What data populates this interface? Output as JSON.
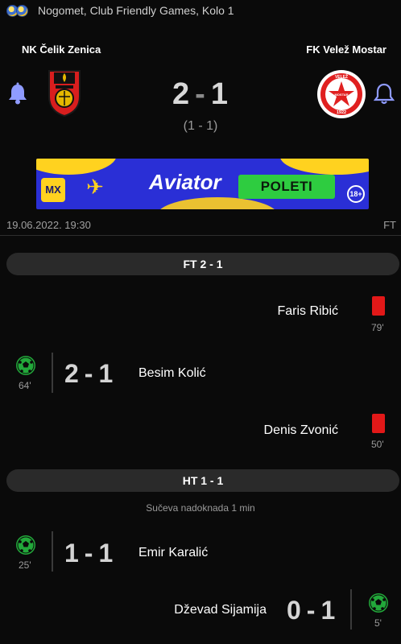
{
  "header": {
    "competition": "Nogomet, Club Friendly Games, Kolo 1",
    "competition_icon": "football-balls-icon"
  },
  "match": {
    "home_team": "NK Čelik Zenica",
    "away_team": "FK Velež Mostar",
    "home_score": "2",
    "away_score": "1",
    "halftime": "(1 - 1)",
    "date": "19.06.2022. 19:30",
    "status": "FT",
    "score_color": "#d8d8d8"
  },
  "ad": {
    "brand_short": "MX",
    "product": "Aviator",
    "cta": "POLETI",
    "age_badge": "18+",
    "bg_color": "#2a2fd6",
    "accent": "#ffd21f",
    "cta_color": "#2ecc40"
  },
  "crests": {
    "away_year": "1922",
    "away_top": "VELEŽ",
    "away_bottom": "MOSTAR"
  },
  "sections": {
    "ft_label": "FT 2 - 1",
    "ht_label": "HT 1 - 1",
    "stoppage_note": "Sučeva nadoknada 1 min"
  },
  "events": [
    {
      "type": "red-card",
      "side": "away",
      "player": "Faris Ribić",
      "minute": "79'"
    },
    {
      "type": "goal",
      "side": "home",
      "player": "Besim Kolić",
      "minute": "64'",
      "home": "2",
      "away": "1"
    },
    {
      "type": "red-card",
      "side": "away",
      "player": "Denis Zvonić",
      "minute": "50'"
    },
    {
      "type": "goal",
      "side": "home",
      "player": "Emir Karalić",
      "minute": "25'",
      "home": "1",
      "away": "1"
    },
    {
      "type": "goal",
      "side": "away",
      "player": "Dževad Sijamija",
      "minute": "5'",
      "home": "0",
      "away": "1"
    }
  ],
  "colors": {
    "goal_green": "#22a83a",
    "red_card": "#e21818",
    "bell": "#8f9bff",
    "pill_bg": "#2a2a2a"
  }
}
